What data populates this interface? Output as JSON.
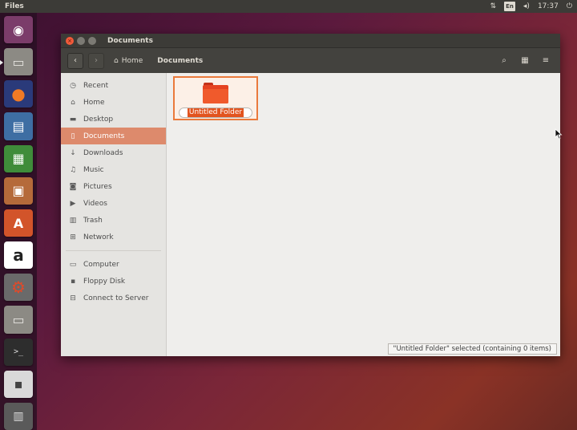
{
  "top_panel": {
    "app_title": "Files",
    "keyboard_label": "En",
    "clock": "17:37",
    "icons": [
      "network-icon",
      "keyboard-icon",
      "volume-icon",
      "power-icon"
    ]
  },
  "launcher": {
    "items": [
      {
        "name": "ubuntu-dash-icon",
        "glyph": "◉"
      },
      {
        "name": "files-app-icon",
        "glyph": "▭"
      },
      {
        "name": "firefox-icon",
        "glyph": "●"
      },
      {
        "name": "writer-icon",
        "glyph": "▤"
      },
      {
        "name": "calc-icon",
        "glyph": "▦"
      },
      {
        "name": "impress-icon",
        "glyph": "▣"
      },
      {
        "name": "software-center-icon",
        "glyph": "A"
      },
      {
        "name": "amazon-icon",
        "glyph": "a"
      },
      {
        "name": "settings-icon",
        "glyph": "⚙"
      },
      {
        "name": "files-app-icon-2",
        "glyph": "▭"
      },
      {
        "name": "terminal-icon",
        "glyph": ">_"
      },
      {
        "name": "floppy-icon",
        "glyph": "▪"
      },
      {
        "name": "trash-icon",
        "glyph": "▥"
      }
    ]
  },
  "window": {
    "title": "Documents",
    "breadcrumb": {
      "home_label": "Home",
      "current_label": "Documents"
    },
    "sidebar": {
      "places": [
        {
          "label": "Recent",
          "icon": "clock-icon",
          "glyph": "◷"
        },
        {
          "label": "Home",
          "icon": "home-icon",
          "glyph": "⌂"
        },
        {
          "label": "Desktop",
          "icon": "desktop-icon",
          "glyph": "▬"
        },
        {
          "label": "Documents",
          "icon": "document-icon",
          "glyph": "▯",
          "selected": true
        },
        {
          "label": "Downloads",
          "icon": "download-icon",
          "glyph": "↓"
        },
        {
          "label": "Music",
          "icon": "music-icon",
          "glyph": "♫"
        },
        {
          "label": "Pictures",
          "icon": "camera-icon",
          "glyph": "◙"
        },
        {
          "label": "Videos",
          "icon": "video-icon",
          "glyph": "▶"
        },
        {
          "label": "Trash",
          "icon": "trash-icon",
          "glyph": "▥"
        },
        {
          "label": "Network",
          "icon": "network-icon",
          "glyph": "⊞"
        }
      ],
      "devices": [
        {
          "label": "Computer",
          "icon": "computer-icon",
          "glyph": "▭"
        },
        {
          "label": "Floppy Disk",
          "icon": "floppy-icon",
          "glyph": "▪"
        },
        {
          "label": "Connect to Server",
          "icon": "server-icon",
          "glyph": "⊟"
        }
      ]
    },
    "content": {
      "folder_name": "Untitled Folder"
    },
    "status": "\"Untitled Folder\" selected  (containing 0 items)"
  },
  "colors": {
    "accent": "#dd8a6c",
    "folder": "#e54321",
    "titlebar": "#3c3b37"
  }
}
